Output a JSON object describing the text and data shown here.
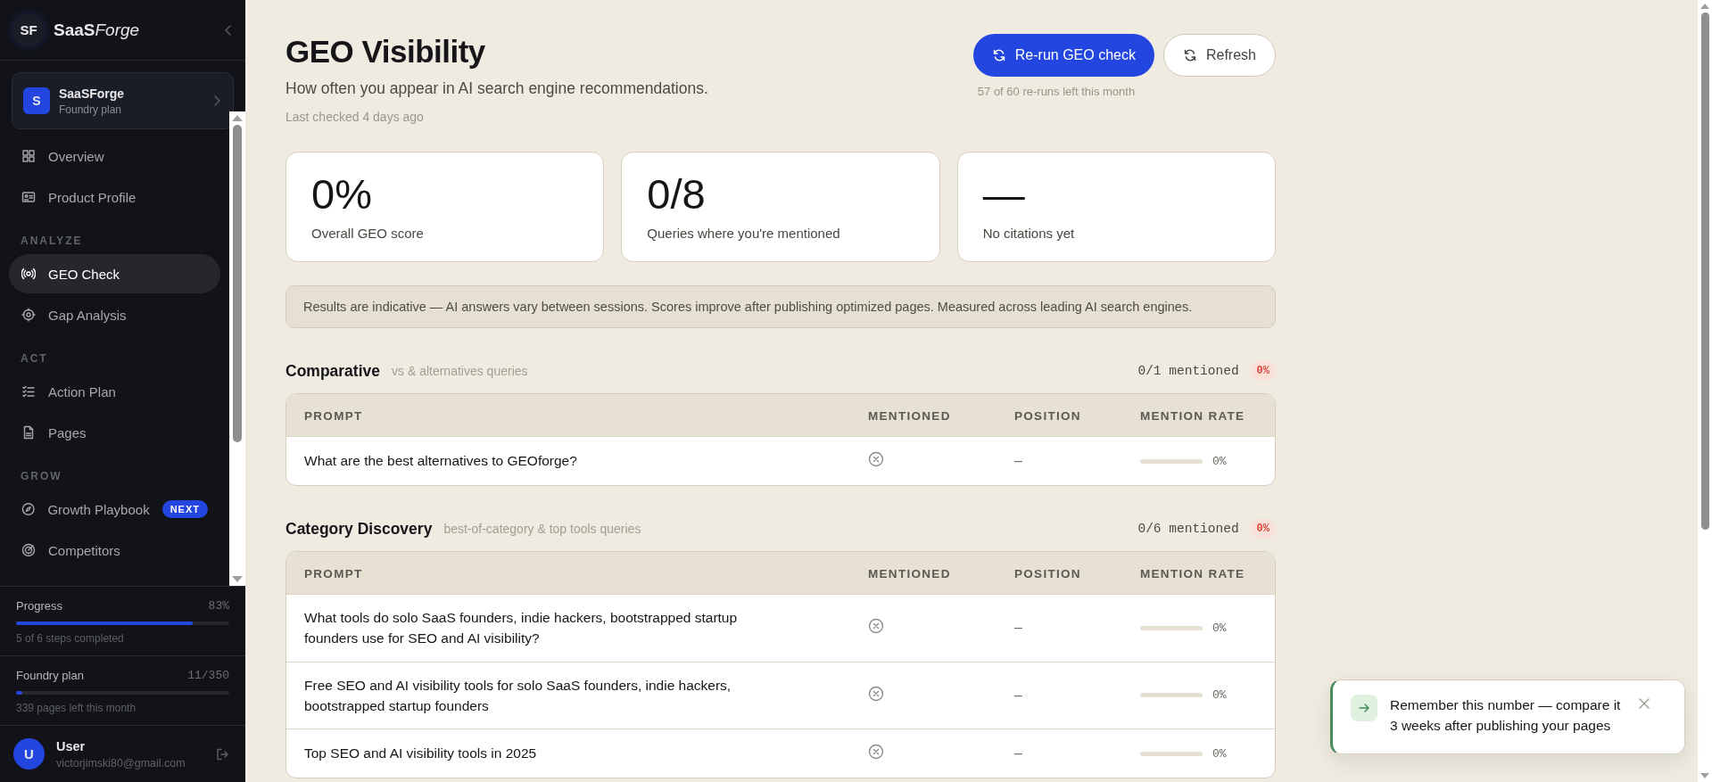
{
  "sidebar": {
    "logo_mark": "SF",
    "brand": "SaaS",
    "brand_italic": "Forge",
    "workspace": {
      "initial": "S",
      "name": "SaaSForge",
      "plan": "Foundry plan"
    },
    "sections": [
      {
        "items": [
          {
            "label": "Overview",
            "selected": false
          },
          {
            "label": "Product Profile",
            "selected": false
          }
        ]
      },
      {
        "heading": "ANALYZE",
        "items": [
          {
            "label": "GEO Check",
            "selected": true
          },
          {
            "label": "Gap Analysis",
            "selected": false
          }
        ]
      },
      {
        "heading": "ACT",
        "items": [
          {
            "label": "Action Plan",
            "selected": false
          },
          {
            "label": "Pages",
            "selected": false
          }
        ]
      },
      {
        "heading": "GROW",
        "items": [
          {
            "label": "Growth Playbook",
            "selected": false,
            "badge": "NEXT"
          },
          {
            "label": "Competitors",
            "selected": false
          }
        ]
      }
    ],
    "meters": [
      {
        "label": "Progress",
        "value": "83%",
        "level": 0.83,
        "caption": "5 of 6 steps completed"
      },
      {
        "label": "Foundry plan",
        "value": "11/350",
        "level": 0.03,
        "caption": "339 pages left this month"
      }
    ],
    "user": {
      "initial": "U",
      "name": "User",
      "email": "victorjimski80@gmail.com"
    }
  },
  "header": {
    "title": "GEO Visibility",
    "subtitle": "How often you appear in AI search engine recommendations.",
    "last_checked": "Last checked 4 days ago",
    "buttons": [
      {
        "label": "Re-run GEO check",
        "kind": "primary"
      },
      {
        "label": "Refresh",
        "kind": "secondary"
      }
    ],
    "rerun_note": "57 of 60 re-runs left this month"
  },
  "stats": [
    {
      "value": "0%",
      "label": "Overall GEO score"
    },
    {
      "value": "0/8",
      "label": "Queries where you're mentioned"
    },
    {
      "value": "—",
      "label": "No citations yet"
    }
  ],
  "notice": "Results are indicative — AI answers vary between sessions. Scores improve after publishing optimized pages. Measured across leading AI search engines.",
  "query_groups": [
    {
      "title": "Comparative",
      "subtitle": "vs & alternatives queries",
      "summary": "0/1 mentioned",
      "rate": "0%",
      "columns": [
        "PROMPT",
        "MENTIONED",
        "POSITION",
        "MENTION RATE"
      ],
      "rows": [
        {
          "prompt": "What are the best alternatives to GEOforge?",
          "mentioned": false,
          "position": "–",
          "rate": "0%",
          "level": 0
        }
      ]
    },
    {
      "title": "Category Discovery",
      "subtitle": "best-of-category & top tools queries",
      "summary": "0/6 mentioned",
      "rate": "0%",
      "columns": [
        "PROMPT",
        "MENTIONED",
        "POSITION",
        "MENTION RATE"
      ],
      "rows": [
        {
          "prompt": "What tools do solo SaaS founders, indie hackers, bootstrapped startup founders use for SEO and AI visibility?",
          "mentioned": false,
          "position": "–",
          "rate": "0%",
          "level": 0
        },
        {
          "prompt": "Free SEO and AI visibility tools for solo SaaS founders, indie hackers, bootstrapped startup founders",
          "mentioned": false,
          "position": "–",
          "rate": "0%",
          "level": 0
        },
        {
          "prompt": "Top SEO and AI visibility tools in 2025",
          "mentioned": false,
          "position": "–",
          "rate": "0%",
          "level": 0
        }
      ]
    }
  ],
  "toast": {
    "text": "Remember this number — compare it 3 weeks after publishing your pages"
  }
}
